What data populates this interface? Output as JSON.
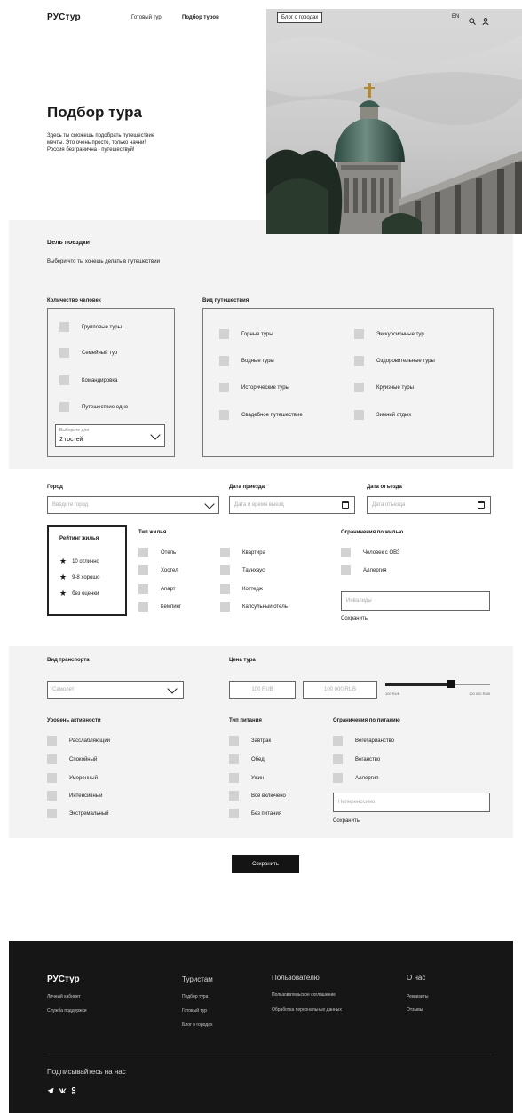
{
  "header": {
    "logo": "РУСтур",
    "nav": [
      "Готовый тур",
      "Подбор туров"
    ],
    "blog_button": "Блог о городах",
    "lang": "EN"
  },
  "hero": {
    "title": "Подбор тура",
    "description_lines": [
      "Здесь ты сможешь подобрать путешествие",
      "мечты. Это очень просто, только начни!",
      "Россия безгранична - путешествуй!"
    ]
  },
  "purpose": {
    "title": "Цель поездки",
    "subtitle": "Выбери что ты хочешь делать в путешествии"
  },
  "people": {
    "title": "Количество человек",
    "options": [
      "Групповые туры",
      "Семейный тур",
      "Командировка",
      "Путешествие одно"
    ],
    "select_label": "Выберите для",
    "select_value": "2 гостей"
  },
  "travel_type": {
    "title": "Вид путешествия",
    "left": [
      "Горные туры",
      "Водные туры",
      "Исторические туры",
      "Свадебное путешествие"
    ],
    "right": [
      "Экскурсионные тур",
      "Оздоровительные туры",
      "Круизные туры",
      "Зимний отдых"
    ]
  },
  "city": {
    "label": "Город",
    "placeholder": "Введите город"
  },
  "arrival": {
    "label": "Дата приезда",
    "placeholder": "Дата и время выезд"
  },
  "departure": {
    "label": "Дата отъезда",
    "placeholder": "Дата отъезда"
  },
  "rating": {
    "title": "Рейтинг жилья",
    "items": [
      "10 отлично",
      "9-8 хорошо",
      "без оценки"
    ]
  },
  "housing": {
    "title": "Тип жилья",
    "col1": [
      "Отель",
      "Хостел",
      "Апарт",
      "Кемпинг"
    ],
    "col2": [
      "Квартира",
      "Таунхаус",
      "Коттедж",
      "Капсульный отель"
    ]
  },
  "housing_limits": {
    "title": "Ограничения по жилью",
    "items": [
      "Человек с ОВЗ",
      "Аллергия"
    ],
    "input_placeholder": "Инвалиды",
    "save_link": "Сохранить"
  },
  "transport": {
    "label": "Вид транспорта",
    "placeholder": "Самолет"
  },
  "price": {
    "label": "Цена тура",
    "min": "100 RUB",
    "max": "100 000 RUB",
    "slider_min": "100 RUB",
    "slider_max": "100 000 RUB",
    "slider_fraction": 0.63
  },
  "activity": {
    "title": "Уровень активности",
    "items": [
      "Расслабляющий",
      "Спокойный",
      "Умеренный",
      "Интенсивный",
      "Экстремальный"
    ]
  },
  "food": {
    "title": "Тип питания",
    "items": [
      "Завтрак",
      "Обед",
      "Ужин",
      "Всё включено",
      "Без питания"
    ]
  },
  "food_limits": {
    "title": "Ограничения по питанию",
    "items": [
      "Вегетарианство",
      "Веганство",
      "Аллергия"
    ],
    "input_placeholder": "Непереносимо",
    "save_link": "Сохранить"
  },
  "submit_label": "Сохранить",
  "footer": {
    "logo": "РУСтур",
    "account": "Личный кабинет",
    "support": "Служба поддержки",
    "tourists": {
      "title": "Туристам",
      "links": [
        "Подбор тура",
        "Готовый тур",
        "Блог о городах"
      ]
    },
    "users": {
      "title": "Пользователю",
      "links": [
        "Пользовательское соглашение",
        "Обработка персональных данных"
      ]
    },
    "about": {
      "title": "О нас",
      "links": [
        "Реквизиты",
        "Отзывы"
      ]
    },
    "subscribe": "Подписывайтесь на нас",
    "socials": [
      "telegram-icon",
      "vk-icon",
      "ok-icon"
    ]
  }
}
